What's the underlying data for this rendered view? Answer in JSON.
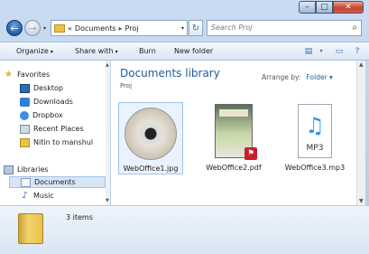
{
  "window": {
    "controls": {
      "minimize": "–",
      "maximize": "□",
      "close": "✕"
    }
  },
  "nav": {
    "back": "←",
    "forward": "→",
    "address_prefix": "«",
    "breadcrumb": [
      "Documents",
      "Proj"
    ],
    "breadcrumb_sep": "▸",
    "refresh": "↻",
    "search_placeholder": "Search Proj"
  },
  "toolbar": {
    "organize": "Organize",
    "share_with": "Share with",
    "burn": "Burn",
    "new_folder": "New folder"
  },
  "sidebar": {
    "favorites": "Favorites",
    "items": [
      "Desktop",
      "Downloads",
      "Dropbox",
      "Recent Places",
      "Nitin to manshul"
    ],
    "libraries": "Libraries",
    "library_items": [
      "Documents",
      "Music"
    ]
  },
  "main": {
    "title": "Documents library",
    "subtitle": "Proj",
    "arrange_label": "Arrange by:",
    "arrange_value": "Folder",
    "files": [
      {
        "name": "WebOffice1.jpg",
        "type": "jpg"
      },
      {
        "name": "WebOffice2.pdf",
        "type": "pdf"
      },
      {
        "name": "WebOffice3.mp3",
        "type": "mp3",
        "badge": "MP3"
      }
    ]
  },
  "details": {
    "count": "3 items"
  },
  "colors": {
    "accent": "#1e5d99",
    "selection": "#d7e6f7",
    "close": "#c4432c"
  }
}
